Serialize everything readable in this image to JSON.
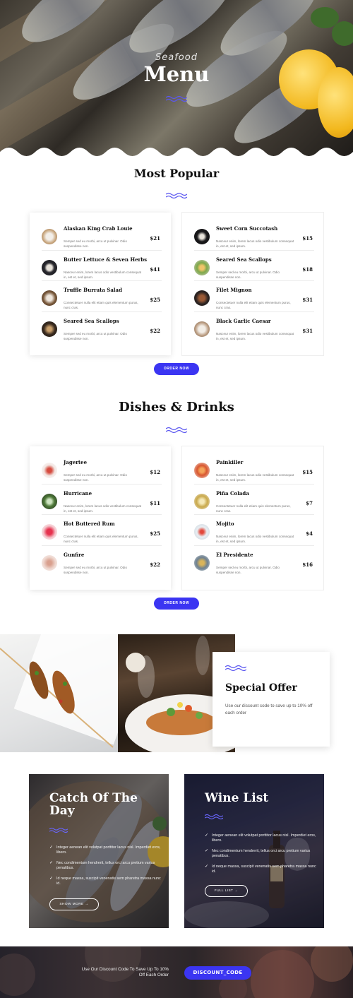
{
  "hero": {
    "subtitle": "Seafood",
    "title": "Menu"
  },
  "popular": {
    "heading": "Most Popular",
    "left": [
      {
        "name": "Alaskan King Crab Louie",
        "desc": "Semper sed eu morbi, arcu ut pulvinar. Odio suspendisse non.",
        "price": "$21"
      },
      {
        "name": "Butter Lettuce & Seven Herbs",
        "desc": "Nasceur enim, lorem lacus odio vestibulum consequat in, est et, sed ipsum.",
        "price": "$41"
      },
      {
        "name": "Truffle Burrata Salad",
        "desc": "Consectetuer nulla elit etiam quis elementum purus, nunc cras.",
        "price": "$25"
      },
      {
        "name": "Seared Sea Scallops",
        "desc": "Semper sed eu morbi, arcu ut pulvinar. Odio suspendisse non.",
        "price": "$22"
      }
    ],
    "right": [
      {
        "name": "Sweet Corn Succotash",
        "desc": "Nasceur enim, lorem lacus odio vestibulum consequat in, est et, sed ipsum.",
        "price": "$15"
      },
      {
        "name": "Seared Sea Scallops",
        "desc": "Semper sed eu morbi, arcu ut pulvinar. Odio suspendisse non.",
        "price": "$18"
      },
      {
        "name": "Filet Mignon",
        "desc": "Consectetuer nulla elit etiam quis elementum purus, nunc cras.",
        "price": "$31"
      },
      {
        "name": "Black Garlic Caesar",
        "desc": "Nasceur enim, lorem lacus odio vestibulum consequat in, est et, sed ipsum.",
        "price": "$31"
      }
    ],
    "button": "ORDER NOW"
  },
  "dishes": {
    "heading": "Dishes & Drinks",
    "left": [
      {
        "name": "Jagertee",
        "desc": "Semper sed eu morbi, arcu ut pulvinar. Odio suspendisse non.",
        "price": "$12"
      },
      {
        "name": "Hurricane",
        "desc": "Nasceur enim, lorem lacus odio vestibulum consequat in, est et, sed ipsum.",
        "price": "$11"
      },
      {
        "name": "Hot Buttered Rum",
        "desc": "Consectetuer nulla elit etiam quis elementum purus, nunc cras.",
        "price": "$25"
      },
      {
        "name": "Gunfire",
        "desc": "Semper sed eu morbi, arcu ut pulvinar. Odio suspendisse non.",
        "price": "$22"
      }
    ],
    "right": [
      {
        "name": "Painkiller",
        "desc": "Nasceur enim, lorem lacus odio vestibulum consequat in, est et, sed ipsum.",
        "price": "$15"
      },
      {
        "name": "Piña Colada",
        "desc": "Consectetuer nulla elit etiam quis elementum purus, nunc cras.",
        "price": "$7"
      },
      {
        "name": "Mojito",
        "desc": "Nasceur enim, lorem lacus odio vestibulum consequat in, est et, sed ipsum.",
        "price": "$4"
      },
      {
        "name": "El Presidente",
        "desc": "Semper sed eu morbi, arcu ut pulvinar. Odio suspendisse non.",
        "price": "$16"
      }
    ],
    "button": "ORDER NOW"
  },
  "offer": {
    "title": "Special Offer",
    "text": "Use our discount code to save up to 10% off each order"
  },
  "catch": {
    "title": "Catch Of The Day",
    "bullets": [
      "Integer aenean elit volutpat porttitor lacus nisl. Imperdiet eros, libero.",
      "Nec condimentum hendrerit, tellus orci arcu pretium varius penatibus.",
      "Id neque massa, suscipit venenatis sem pharetra massa nunc id."
    ],
    "button": "SHOW MORE →"
  },
  "wine": {
    "title": "Wine List",
    "bullets": [
      "Integer aenean elit volutpat porttitor lacus nisl. Imperdiet eros, libero.",
      "Nec condimentum hendrerit, tellus orci arcu pretium varius penatibus.",
      "Id neque massa, suscipit venenatis sem pharetra massa nunc id."
    ],
    "button": "FULL LIST →"
  },
  "footer": {
    "text": "Use Our Discount Code To Save Up To 10% Off Each Order",
    "code": "DISCOUNT_CODE"
  },
  "colors": {
    "accent": "#3b35f2",
    "wave": "#5b57f0"
  }
}
